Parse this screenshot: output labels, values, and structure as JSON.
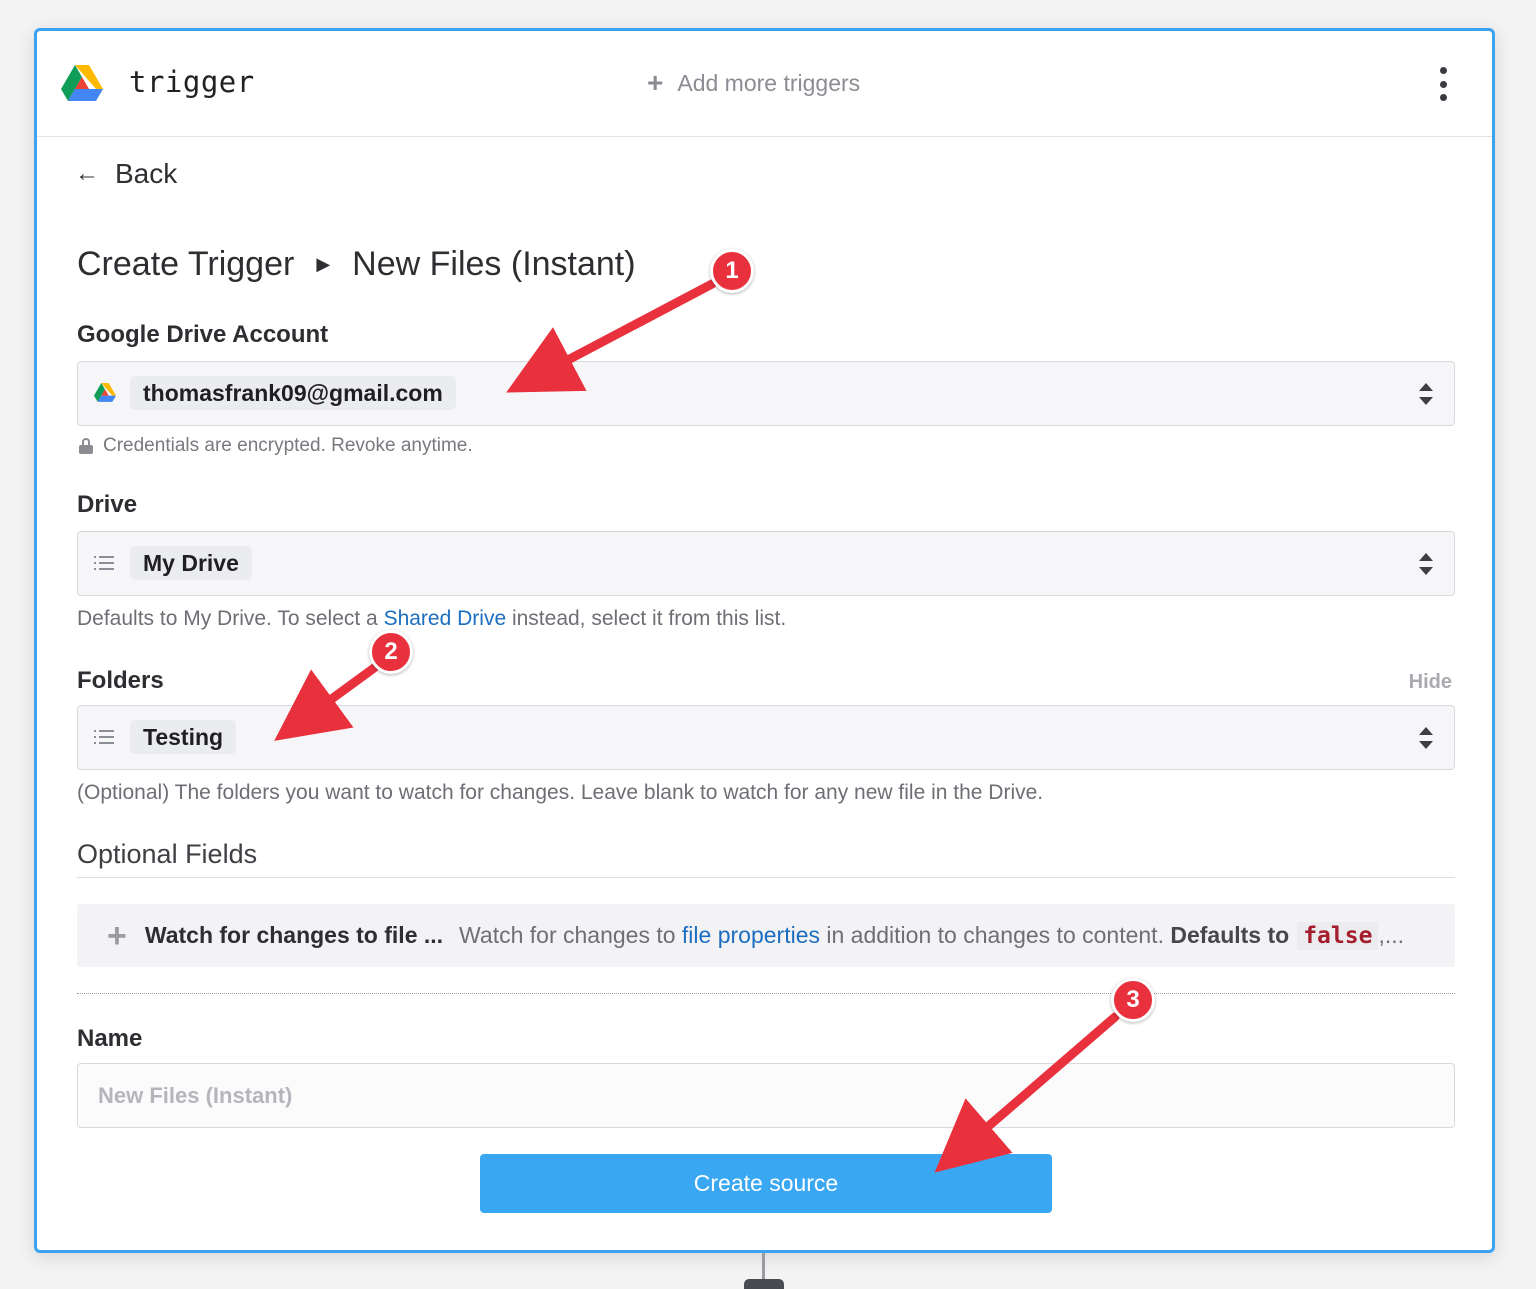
{
  "header": {
    "app_name": "trigger",
    "add_more_label": "Add more triggers"
  },
  "nav": {
    "back_label": "Back"
  },
  "breadcrumb": {
    "parent": "Create Trigger",
    "current": "New Files (Instant)"
  },
  "account": {
    "label": "Google Drive Account",
    "value": "thomasfrank09@gmail.com",
    "security_note": "Credentials are encrypted. Revoke anytime."
  },
  "drive": {
    "label": "Drive",
    "value": "My Drive",
    "hint_before": "Defaults to My Drive. To select a ",
    "hint_link": "Shared Drive",
    "hint_after": " instead, select it from this list."
  },
  "folders": {
    "label": "Folders",
    "hide_label": "Hide",
    "value": "Testing",
    "hint": "(Optional) The folders you want to watch for changes. Leave blank to watch for any new file in the Drive."
  },
  "optional_fields": {
    "title": "Optional Fields",
    "items": [
      {
        "name": "Watch for changes to file ...",
        "desc_before": "Watch for changes to ",
        "desc_link": "file properties",
        "desc_after": " in addition to changes to content. ",
        "desc_strong": "Defaults to",
        "code": "false",
        "desc_tail": ",..."
      }
    ]
  },
  "name_field": {
    "label": "Name",
    "placeholder": "New Files (Instant)"
  },
  "submit": {
    "label": "Create source"
  },
  "annotations": [
    "1",
    "2",
    "3"
  ],
  "colors": {
    "accent": "#3aa7f3",
    "annotation": "#e8313d",
    "link": "#1c6ec0"
  }
}
